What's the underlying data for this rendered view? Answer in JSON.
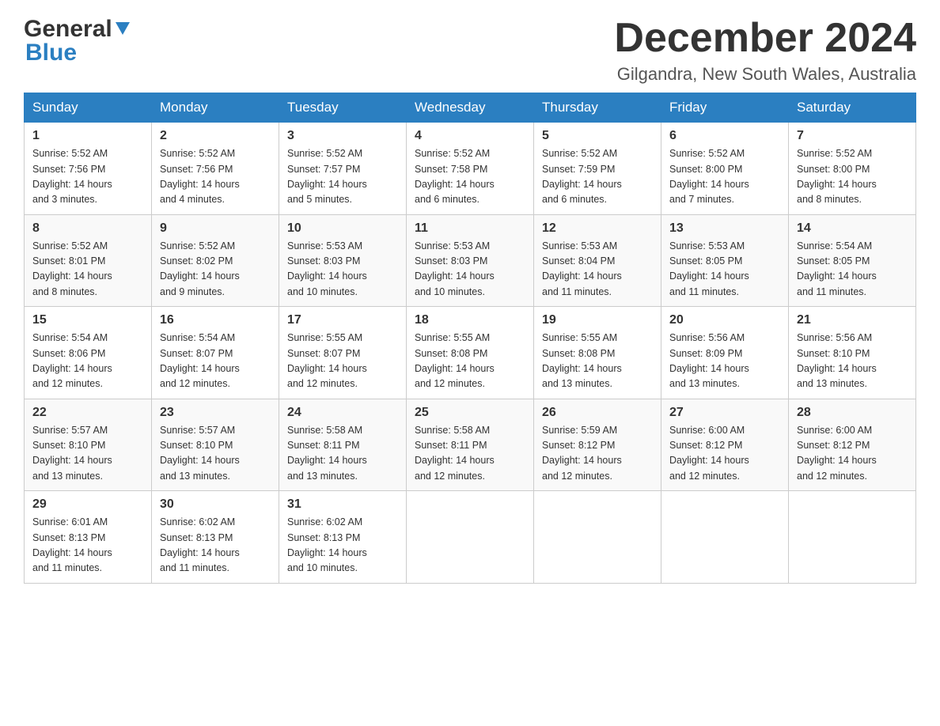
{
  "header": {
    "logo_general": "General",
    "logo_blue": "Blue",
    "month_title": "December 2024",
    "location": "Gilgandra, New South Wales, Australia"
  },
  "days_of_week": [
    "Sunday",
    "Monday",
    "Tuesday",
    "Wednesday",
    "Thursday",
    "Friday",
    "Saturday"
  ],
  "weeks": [
    [
      {
        "day": "1",
        "sunrise": "5:52 AM",
        "sunset": "7:56 PM",
        "daylight": "14 hours and 3 minutes."
      },
      {
        "day": "2",
        "sunrise": "5:52 AM",
        "sunset": "7:56 PM",
        "daylight": "14 hours and 4 minutes."
      },
      {
        "day": "3",
        "sunrise": "5:52 AM",
        "sunset": "7:57 PM",
        "daylight": "14 hours and 5 minutes."
      },
      {
        "day": "4",
        "sunrise": "5:52 AM",
        "sunset": "7:58 PM",
        "daylight": "14 hours and 6 minutes."
      },
      {
        "day": "5",
        "sunrise": "5:52 AM",
        "sunset": "7:59 PM",
        "daylight": "14 hours and 6 minutes."
      },
      {
        "day": "6",
        "sunrise": "5:52 AM",
        "sunset": "8:00 PM",
        "daylight": "14 hours and 7 minutes."
      },
      {
        "day": "7",
        "sunrise": "5:52 AM",
        "sunset": "8:00 PM",
        "daylight": "14 hours and 8 minutes."
      }
    ],
    [
      {
        "day": "8",
        "sunrise": "5:52 AM",
        "sunset": "8:01 PM",
        "daylight": "14 hours and 8 minutes."
      },
      {
        "day": "9",
        "sunrise": "5:52 AM",
        "sunset": "8:02 PM",
        "daylight": "14 hours and 9 minutes."
      },
      {
        "day": "10",
        "sunrise": "5:53 AM",
        "sunset": "8:03 PM",
        "daylight": "14 hours and 10 minutes."
      },
      {
        "day": "11",
        "sunrise": "5:53 AM",
        "sunset": "8:03 PM",
        "daylight": "14 hours and 10 minutes."
      },
      {
        "day": "12",
        "sunrise": "5:53 AM",
        "sunset": "8:04 PM",
        "daylight": "14 hours and 11 minutes."
      },
      {
        "day": "13",
        "sunrise": "5:53 AM",
        "sunset": "8:05 PM",
        "daylight": "14 hours and 11 minutes."
      },
      {
        "day": "14",
        "sunrise": "5:54 AM",
        "sunset": "8:05 PM",
        "daylight": "14 hours and 11 minutes."
      }
    ],
    [
      {
        "day": "15",
        "sunrise": "5:54 AM",
        "sunset": "8:06 PM",
        "daylight": "14 hours and 12 minutes."
      },
      {
        "day": "16",
        "sunrise": "5:54 AM",
        "sunset": "8:07 PM",
        "daylight": "14 hours and 12 minutes."
      },
      {
        "day": "17",
        "sunrise": "5:55 AM",
        "sunset": "8:07 PM",
        "daylight": "14 hours and 12 minutes."
      },
      {
        "day": "18",
        "sunrise": "5:55 AM",
        "sunset": "8:08 PM",
        "daylight": "14 hours and 12 minutes."
      },
      {
        "day": "19",
        "sunrise": "5:55 AM",
        "sunset": "8:08 PM",
        "daylight": "14 hours and 13 minutes."
      },
      {
        "day": "20",
        "sunrise": "5:56 AM",
        "sunset": "8:09 PM",
        "daylight": "14 hours and 13 minutes."
      },
      {
        "day": "21",
        "sunrise": "5:56 AM",
        "sunset": "8:10 PM",
        "daylight": "14 hours and 13 minutes."
      }
    ],
    [
      {
        "day": "22",
        "sunrise": "5:57 AM",
        "sunset": "8:10 PM",
        "daylight": "14 hours and 13 minutes."
      },
      {
        "day": "23",
        "sunrise": "5:57 AM",
        "sunset": "8:10 PM",
        "daylight": "14 hours and 13 minutes."
      },
      {
        "day": "24",
        "sunrise": "5:58 AM",
        "sunset": "8:11 PM",
        "daylight": "14 hours and 13 minutes."
      },
      {
        "day": "25",
        "sunrise": "5:58 AM",
        "sunset": "8:11 PM",
        "daylight": "14 hours and 12 minutes."
      },
      {
        "day": "26",
        "sunrise": "5:59 AM",
        "sunset": "8:12 PM",
        "daylight": "14 hours and 12 minutes."
      },
      {
        "day": "27",
        "sunrise": "6:00 AM",
        "sunset": "8:12 PM",
        "daylight": "14 hours and 12 minutes."
      },
      {
        "day": "28",
        "sunrise": "6:00 AM",
        "sunset": "8:12 PM",
        "daylight": "14 hours and 12 minutes."
      }
    ],
    [
      {
        "day": "29",
        "sunrise": "6:01 AM",
        "sunset": "8:13 PM",
        "daylight": "14 hours and 11 minutes."
      },
      {
        "day": "30",
        "sunrise": "6:02 AM",
        "sunset": "8:13 PM",
        "daylight": "14 hours and 11 minutes."
      },
      {
        "day": "31",
        "sunrise": "6:02 AM",
        "sunset": "8:13 PM",
        "daylight": "14 hours and 10 minutes."
      },
      null,
      null,
      null,
      null
    ]
  ],
  "labels": {
    "sunrise": "Sunrise:",
    "sunset": "Sunset:",
    "daylight": "Daylight:"
  }
}
